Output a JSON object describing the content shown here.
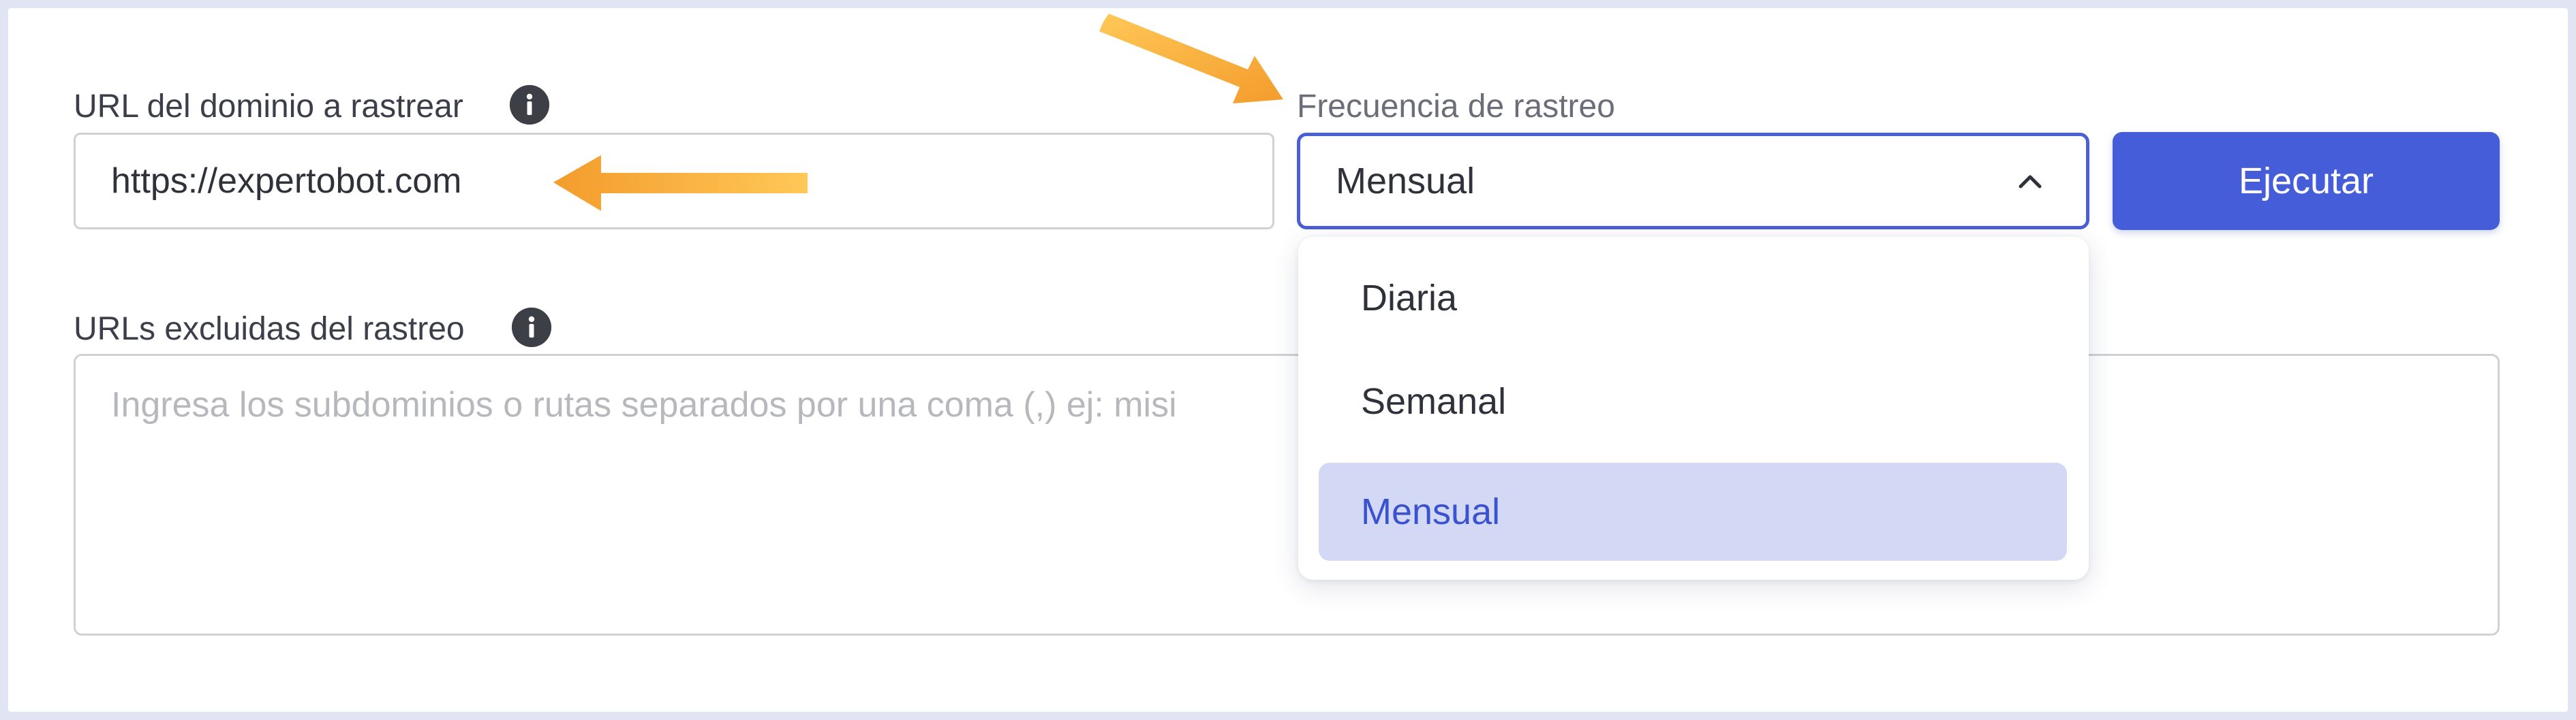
{
  "domain_field": {
    "label": "URL del dominio a rastrear",
    "value": "https://expertobot.com"
  },
  "frequency_field": {
    "label": "Frecuencia de rastreo",
    "selected": "Mensual",
    "options": [
      "Diaria",
      "Semanal",
      "Mensual"
    ]
  },
  "run_button": {
    "label": "Ejecutar"
  },
  "excluded_field": {
    "label": "URLs excluidas del rastreo",
    "placeholder": "Ingresa los subdominios o rutas separados por una coma (,) ej: misi"
  },
  "colors": {
    "accent": "#465dd9",
    "selected_option_bg": "#d3d8f5",
    "annotation_arrow": "#f7b53b"
  },
  "icons": {
    "info": "info-icon",
    "chevron": "chevron-up-icon",
    "annotation": "arrow-annotation"
  }
}
